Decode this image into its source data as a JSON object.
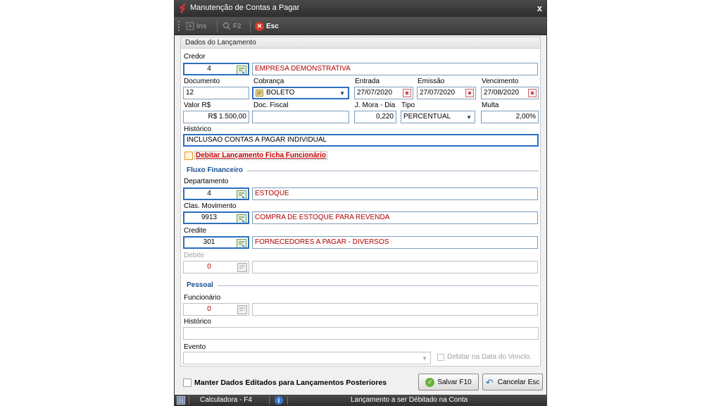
{
  "window": {
    "title": "Manutenção de Contas a Pagar",
    "close_label": "x"
  },
  "toolbar": {
    "ins_label": "Ins",
    "f2_label": "F2",
    "esc_label": "Esc"
  },
  "group_title": "Dados do Lançamento",
  "credor": {
    "label": "Credor",
    "code": "4",
    "name": "EMPRESA DEMONSTRATIVA"
  },
  "documento": {
    "label": "Documento",
    "value": "12"
  },
  "cobranca": {
    "label": "Cobrança",
    "value": "BOLETO"
  },
  "entrada": {
    "label": "Entrada",
    "value": "27/07/2020"
  },
  "emissao": {
    "label": "Emissão",
    "value": "27/07/2020"
  },
  "vencimento": {
    "label": "Vencimento",
    "value": "27/08/2020"
  },
  "valor": {
    "label": "Valor R$",
    "value": "R$ 1.500,00"
  },
  "doc_fiscal": {
    "label": "Doc. Fiscal",
    "value": ""
  },
  "juros": {
    "label": "J. Mora - Dia",
    "value": "0,220"
  },
  "tipo": {
    "label": "Tipo",
    "value": "PERCENTUAL"
  },
  "multa": {
    "label": "Multa",
    "value": "2,00%"
  },
  "historico": {
    "label": "Histórico",
    "value": "INCLUSAO CONTAS A PAGAR INDIVIDUAL"
  },
  "debitar_funcionario": {
    "label": "Debitar Lançamento Ficha Funcionário",
    "checked": false
  },
  "fluxo": {
    "title": "Fluxo Financeiro",
    "departamento": {
      "label": "Departamento",
      "code": "4",
      "name": "ESTOQUE"
    },
    "clas_movimento": {
      "label": "Clas. Movimento",
      "code": "9913",
      "name": "COMPRA DE ESTOQUE PARA REVENDA"
    },
    "credite": {
      "label": "Credite",
      "code": "301",
      "name": "FORNECEDORES A PAGAR - DIVERSOS"
    },
    "debite": {
      "label": "Debite",
      "code": "0",
      "name": ""
    }
  },
  "pessoal": {
    "title": "Pessoal",
    "funcionario": {
      "label": "Funcionário",
      "code": "0",
      "name": ""
    },
    "historico": {
      "label": "Histórico",
      "value": ""
    },
    "evento": {
      "label": "Evento",
      "value": ""
    },
    "debitar_vencto": {
      "label": "Debitar na Data do Vencto.",
      "checked": false
    }
  },
  "footer": {
    "manter_label": "Manter Dados Editados para Lançamentos Posteriores",
    "salvar_label": "Salvar F10",
    "cancelar_label": "Cancelar Esc"
  },
  "statusbar": {
    "calc_label": "Calculadora - F4",
    "message": "Lançamento a ser Débitado na Conta"
  }
}
